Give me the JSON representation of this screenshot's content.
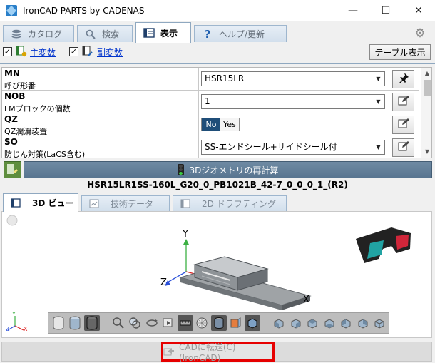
{
  "window": {
    "title": "IronCAD PARTS by CADENAS",
    "minimize": "—",
    "maximize": "☐",
    "close": "✕"
  },
  "tabs": [
    {
      "label": "カタログ",
      "icon": "stack-icon"
    },
    {
      "label": "検索",
      "icon": "search-icon"
    },
    {
      "label": "表示",
      "icon": "display-icon",
      "active": true
    },
    {
      "label": "ヘルプ/更新",
      "icon": "help-icon"
    }
  ],
  "toolbar": {
    "primary_vars": {
      "label": "主変数",
      "checked": true
    },
    "secondary_vars": {
      "label": "副変数",
      "checked": true
    },
    "table_view": "テーブル表示"
  },
  "params": [
    {
      "code": "MN",
      "desc": "呼び形番",
      "value": "HSR15LR",
      "control": "select",
      "button": "pin-icon"
    },
    {
      "code": "NOB",
      "desc": "LMブロックの個数",
      "value": "1",
      "control": "select",
      "button": "edit-icon"
    },
    {
      "code": "QZ",
      "desc": "QZ潤滑装置",
      "control": "toggle",
      "options": [
        "No",
        "Yes"
      ],
      "selected": "No",
      "button": "edit-icon"
    },
    {
      "code": "SO",
      "desc": "防じん対策(LaCS含む)",
      "value": "SS-エンドシール+サイドシール付",
      "control": "select",
      "button": "edit-icon"
    }
  ],
  "recalc": {
    "label": "3Dジオメトリの再計算"
  },
  "part_name": "HSR15LR1SS-160L_G20_0_PB1021B_42-7_0_0_0_1_(R2)",
  "view_tabs": [
    {
      "label": "3D ビュー",
      "active": true
    },
    {
      "label": "技術データ"
    },
    {
      "label": "2D ドラフティング"
    }
  ],
  "viewport": {
    "axes": {
      "x": "X",
      "y": "Y",
      "z": "Z"
    },
    "mini_axes": {
      "y": "Y",
      "x": "X",
      "z": "Z"
    }
  },
  "bottom": {
    "send_label": "CADに転送(C) (IronCAD)"
  },
  "colors": {
    "accent_red": "#e60000",
    "recalc_bg": "#5f7b95",
    "toggle_on": "#1f4e79"
  }
}
